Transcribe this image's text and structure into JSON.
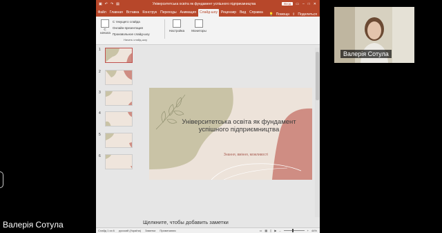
{
  "powerpoint": {
    "title": "Університетська освіта як фундамент успішного підприємництва",
    "login_label": "Вход",
    "tabs": [
      "Файл",
      "Главная",
      "Вставка",
      "Конструк",
      "Переходы",
      "Анимация",
      "Слайд-шоу",
      "Рецензир",
      "Вид",
      "Справка"
    ],
    "active_tab_index": 6,
    "tab_tell": "Помощн",
    "share_label": "Поделиться",
    "ribbon": {
      "start_label": "С начала",
      "list_items": [
        "С текущего слайда",
        "Онлайн-презентация",
        "Произвольное слайд-шоу"
      ],
      "group_label": "Начать слайд-шоу",
      "settings_label": "Настройка",
      "monitors_label": "Мониторы"
    },
    "thumbnails": [
      {
        "number": "1",
        "text": "",
        "selected": true
      },
      {
        "number": "2",
        "text": "",
        "selected": false
      },
      {
        "number": "3",
        "text": "",
        "selected": false
      },
      {
        "number": "4",
        "text": "",
        "selected": false
      },
      {
        "number": "5",
        "text": "",
        "selected": false
      },
      {
        "number": "6",
        "text": "",
        "selected": false
      }
    ],
    "slide": {
      "title": "Університетська освіта як фундамент успішного підприємництва",
      "subtitle": "Знання, вміння, можливості"
    },
    "notes_placeholder": "Щелкните, чтобы добавить заметки",
    "status": {
      "slide_counter": "Слайд 1 из 6",
      "language": "русский (Україна)",
      "notes_btn": "Заметки",
      "comments_btn": "Примечания",
      "zoom": "44%"
    },
    "colors": {
      "accent": "#b7472a",
      "slide_bg": "#ede3da",
      "sage": "#c9c3a6",
      "terracotta": "#cf8d83"
    }
  },
  "participants": {
    "thumbnail_name": "Валерія Сотула",
    "main_name": "Валерія Сотула"
  }
}
